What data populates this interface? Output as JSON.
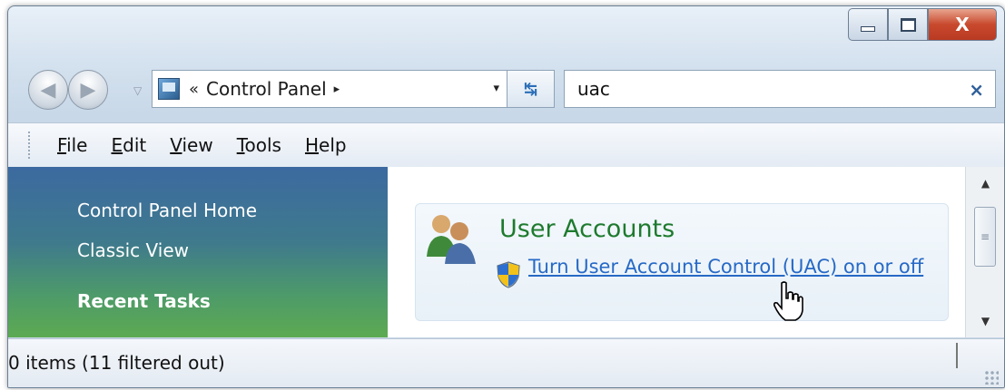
{
  "window": {
    "caption_buttons": {
      "minimize_icon": "minimize-icon",
      "maximize_icon": "maximize-icon",
      "close_label": "X"
    }
  },
  "toolbar": {
    "back_icon": "back-arrow-icon",
    "forward_icon": "forward-arrow-icon",
    "history_dropdown_icon": "chevron-down-icon",
    "address": {
      "chevron": "«",
      "path_label": "Control Panel",
      "arrow": "▸",
      "dropdown": "▾"
    },
    "refresh_label": "↹",
    "search": {
      "value": "uac",
      "clear_label": "×"
    }
  },
  "menu": {
    "items": [
      {
        "first": "F",
        "rest": "ile"
      },
      {
        "first": "E",
        "rest": "dit"
      },
      {
        "first": "V",
        "rest": "iew"
      },
      {
        "first": "T",
        "rest": "ools"
      },
      {
        "first": "H",
        "rest": "elp"
      }
    ]
  },
  "sidebar": {
    "links": [
      "Control Panel Home",
      "Classic View"
    ],
    "section_heading": "Recent Tasks"
  },
  "results": {
    "category_title": "User Accounts",
    "task_link": "Turn User Account Control (UAC) on or off"
  },
  "statusbar": {
    "text": "0 items (11 filtered out)"
  },
  "colors": {
    "accent_link": "#2769c6",
    "category_green": "#1e7a2e",
    "close_red": "#c8492d"
  }
}
